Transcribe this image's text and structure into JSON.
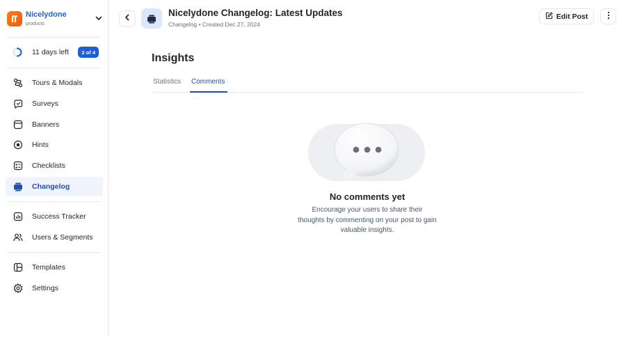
{
  "workspace": {
    "name": "Nicelydone",
    "subtitle": "products"
  },
  "trial": {
    "text": "11 days left",
    "badge": "2 of 4",
    "progress": 0.5
  },
  "sidebar": {
    "items": [
      {
        "label": "Tours & Modals",
        "icon": "tours-icon"
      },
      {
        "label": "Surveys",
        "icon": "surveys-icon"
      },
      {
        "label": "Banners",
        "icon": "banners-icon"
      },
      {
        "label": "Hints",
        "icon": "hints-icon"
      },
      {
        "label": "Checklists",
        "icon": "checklists-icon"
      },
      {
        "label": "Changelog",
        "icon": "changelog-icon",
        "active": true
      },
      {
        "label": "Success Tracker",
        "icon": "success-tracker-icon"
      },
      {
        "label": "Users & Segments",
        "icon": "users-icon"
      },
      {
        "label": "Templates",
        "icon": "templates-icon"
      },
      {
        "label": "Settings",
        "icon": "settings-icon"
      }
    ]
  },
  "header": {
    "title": "Nicelydone Changelog: Latest Updates",
    "meta": "Changelog • Created Dec 27, 2024",
    "edit_label": "Edit Post"
  },
  "main": {
    "section_title": "Insights",
    "tabs": [
      {
        "label": "Statistics",
        "active": false
      },
      {
        "label": "Comments",
        "active": true
      }
    ],
    "empty_state": {
      "title": "No comments yet",
      "description": "Encourage your users to share their thoughts by commenting on your post to gain valuable insights."
    }
  },
  "colors": {
    "accent": "#1e4fb4",
    "brand": "#f25b0a",
    "active_bg": "#eff3fb"
  }
}
